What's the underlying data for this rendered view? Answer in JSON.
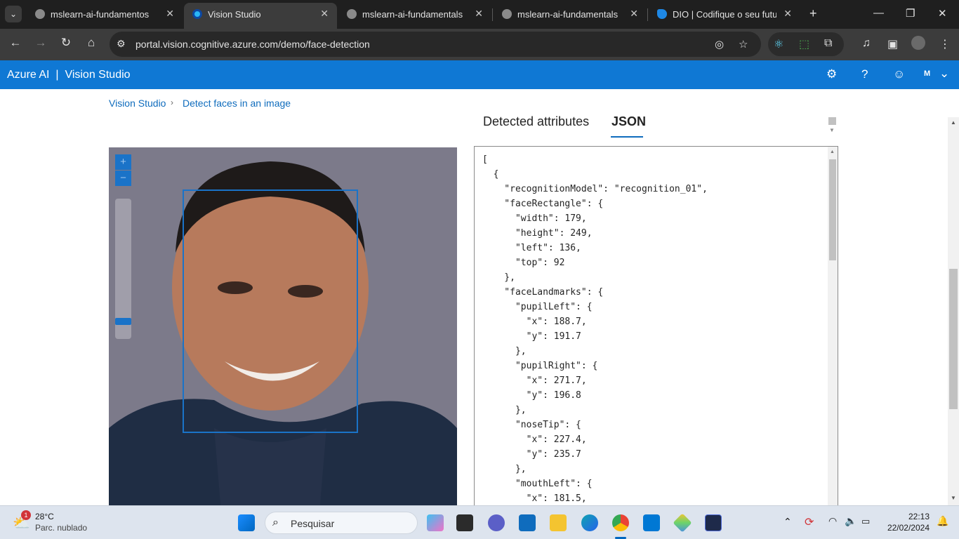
{
  "browser": {
    "tabs": [
      {
        "title": "mslearn-ai-fundamentos",
        "active": false
      },
      {
        "title": "Vision Studio",
        "active": true
      },
      {
        "title": "mslearn-ai-fundamentals",
        "active": false
      },
      {
        "title": "mslearn-ai-fundamentals",
        "active": false
      },
      {
        "title": "DIO | Codifique o seu futuro",
        "active": false
      }
    ],
    "url": "portal.vision.cognitive.azure.com/demo/face-detection"
  },
  "app": {
    "brand": "Azure AI",
    "product": "Vision Studio",
    "avatar_initial": "M"
  },
  "breadcrumb": {
    "items": [
      "Vision Studio",
      "Detect faces in an image"
    ]
  },
  "result_tabs": {
    "attributes": "Detected attributes",
    "json": "JSON",
    "active": "JSON"
  },
  "image_viewer": {
    "zoom_in": "+",
    "zoom_out": "−"
  },
  "json_text": "[\n  {\n    \"recognitionModel\": \"recognition_01\",\n    \"faceRectangle\": {\n      \"width\": 179,\n      \"height\": 249,\n      \"left\": 136,\n      \"top\": 92\n    },\n    \"faceLandmarks\": {\n      \"pupilLeft\": {\n        \"x\": 188.7,\n        \"y\": 191.7\n      },\n      \"pupilRight\": {\n        \"x\": 271.7,\n        \"y\": 196.8\n      },\n      \"noseTip\": {\n        \"x\": 227.4,\n        \"y\": 235.7\n      },\n      \"mouthLeft\": {\n        \"x\": 181.5,",
  "taskbar": {
    "weather_temp": "28°C",
    "weather_desc": "Parc. nublado",
    "weather_badge": "1",
    "search_label": "Pesquisar",
    "time": "22:13",
    "date": "22/02/2024"
  },
  "colors": {
    "accent": "#0f78d4",
    "link": "#0f6cbd",
    "face_box": "#1a73c8"
  }
}
